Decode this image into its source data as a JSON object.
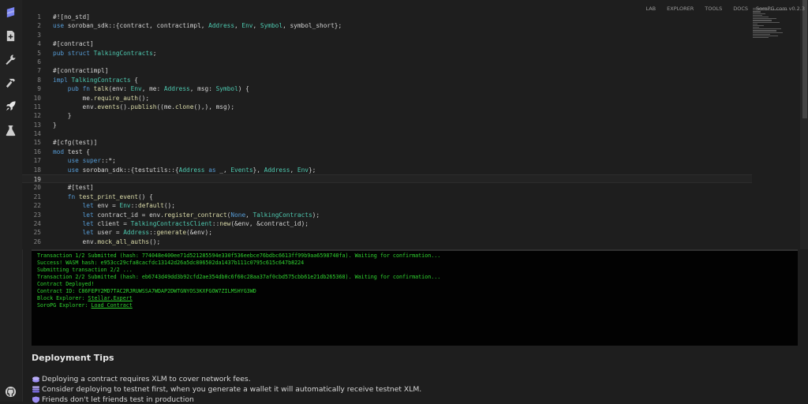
{
  "nav": {
    "lab": "LAB",
    "explorer": "EXPLORER",
    "tools": "TOOLS",
    "docs": "DOCS",
    "brand": "SoroPG.com v0.2.3"
  },
  "sidebar": {
    "icons": [
      "logo-icon",
      "add-file-icon",
      "wrench-icon",
      "hammer-icon",
      "rocket-icon",
      "flask-icon",
      "github-icon"
    ]
  },
  "editor": {
    "current_line": 19,
    "lines": [
      {
        "n": "1",
        "text": "#![no_std]"
      },
      {
        "n": "2",
        "text": "use soroban_sdk::{contract, contractimpl, Address, Env, Symbol, symbol_short};"
      },
      {
        "n": "3",
        "text": ""
      },
      {
        "n": "4",
        "text": "#[contract]"
      },
      {
        "n": "5",
        "text": "pub struct TalkingContracts;"
      },
      {
        "n": "6",
        "text": ""
      },
      {
        "n": "7",
        "text": "#[contractimpl]"
      },
      {
        "n": "8",
        "text": "impl TalkingContracts {"
      },
      {
        "n": "9",
        "text": "    pub fn talk(env: Env, me: Address, msg: Symbol) {"
      },
      {
        "n": "10",
        "text": "        me.require_auth();"
      },
      {
        "n": "11",
        "text": "        env.events().publish((me.clone(),), msg);"
      },
      {
        "n": "12",
        "text": "    }"
      },
      {
        "n": "13",
        "text": "}"
      },
      {
        "n": "14",
        "text": ""
      },
      {
        "n": "15",
        "text": "#[cfg(test)]"
      },
      {
        "n": "16",
        "text": "mod test {"
      },
      {
        "n": "17",
        "text": "    use super::*;"
      },
      {
        "n": "18",
        "text": "    use soroban_sdk::{testutils::{Address as _, Events}, Address, Env};"
      },
      {
        "n": "19",
        "text": ""
      },
      {
        "n": "20",
        "text": "    #[test]"
      },
      {
        "n": "21",
        "text": "    fn test_print_event() {"
      },
      {
        "n": "22",
        "text": "        let env = Env::default();"
      },
      {
        "n": "23",
        "text": "        let contract_id = env.register_contract(None, TalkingContracts);"
      },
      {
        "n": "24",
        "text": "        let client = TalkingContractsClient::new(&env, &contract_id);"
      },
      {
        "n": "25",
        "text": "        let user = Address::generate(&env);"
      },
      {
        "n": "26",
        "text": "        env.mock_all_auths();"
      }
    ]
  },
  "console": {
    "lines": [
      "Transaction 1/2 Submitted (hash: 774048e400ee71d521285594e330f536eebce76bdbc6613ff99b9aa6598740fa). Waiting for confirmation...",
      "Success! WASM hash: e953cc29cfa8cacfdc13142d26a5dc806502da1437b111c0795c615c647b8224",
      "Submitting transaction 2/2 ...",
      "Transaction 2/2 Submitted (hash: eb6743d49dd3b92cfd2ae354db0c6f60c28aa37af0cbd575cbb61e21db265368). Waiting for confirmation...",
      "Contract Deployed!",
      "Contract ID: C86FEPY2MD7TAC2RJRUWSSA7WDAP2DWTGNYOS3KXFGOW7ZILMSHYG3WD"
    ],
    "block_explorer_label": "Block Explorer: ",
    "block_explorer_link": "Stellar.Expert",
    "soropg_explorer_label": "SoroPG Explorer: ",
    "soropg_explorer_link": "Load Contract"
  },
  "tips": {
    "title": "Deployment Tips",
    "items": [
      "Deploying a contract requires XLM to cover network fees.",
      "Consider deploying to testnet first, when you generate a wallet it will automatically receive testnet XLM.",
      "Friends don't let friends test in production"
    ],
    "icons": [
      "coin-icon",
      "stack-icon",
      "shield-icon"
    ]
  },
  "colors": {
    "console_text": "#30d530",
    "background": "#1e1e1e",
    "sidebar": "#222222"
  }
}
